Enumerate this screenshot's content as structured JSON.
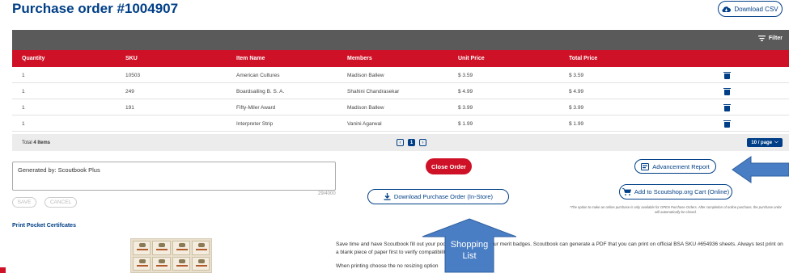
{
  "page": {
    "title": "Purchase order #1004907"
  },
  "actions": {
    "download_csv": "Download CSV",
    "close_order": "Close Order",
    "download_po": "Download Purchase Order (In-Store)",
    "advancement_report": "Advancement Report",
    "add_to_cart": "Add to Scoutshop.org Cart (Online)",
    "save": "SAVE",
    "cancel": "CANCEL"
  },
  "toolbar": {
    "filter_label": "Filter"
  },
  "table": {
    "columns": [
      "Quantity",
      "SKU",
      "Item Name",
      "Members",
      "Unit Price",
      "Total Price"
    ],
    "rows": [
      {
        "qty": "1",
        "sku": "10503",
        "item": "American Cultures",
        "member": "Madison Ballew",
        "unit": "$ 3.59",
        "total": "$ 3.59"
      },
      {
        "qty": "1",
        "sku": "249",
        "item": "Boardsailing B. S. A.",
        "member": "Shahini Chandrasekar",
        "unit": "$ 4.99",
        "total": "$ 4.99"
      },
      {
        "qty": "1",
        "sku": "191",
        "item": "Fifty-Miler Award",
        "member": "Madison Ballew",
        "unit": "$ 3.99",
        "total": "$ 3.99"
      },
      {
        "qty": "1",
        "sku": "",
        "item": "Interpreter Strip",
        "member": "Vanini Agarwal",
        "unit": "$ 1.99",
        "total": "$ 1.99"
      }
    ],
    "footer": {
      "total_prefix": "Total ",
      "total_count": "4 Items",
      "current_page": "1",
      "page_size": "10 / page"
    }
  },
  "notes": {
    "value": "Generated by: Scoutbook Plus",
    "counter": "29/4000"
  },
  "fine_print": "*The option to make an online purchase is only available for OPEN Purchase Orders. After completion of online purchase, the purchase order will automatically be closed.",
  "certificates": {
    "heading": "Print Pocket Certifcates",
    "para1": "Save time and have Scoutbook fill out your pocket certificates for your merit badges. Scoutbook can generate a PDF that you can print on official BSA SKU #654936 sheets. Always test print on a blank piece of paper first to verify compatibility with your sheets.",
    "para2": "When printing choose the no resizing option"
  },
  "callout": {
    "line1": "Shopping",
    "line2": "List"
  },
  "colors": {
    "brand_blue": "#003f87",
    "brand_red": "#ce1126",
    "callout_blue": "#4a7ec4"
  }
}
